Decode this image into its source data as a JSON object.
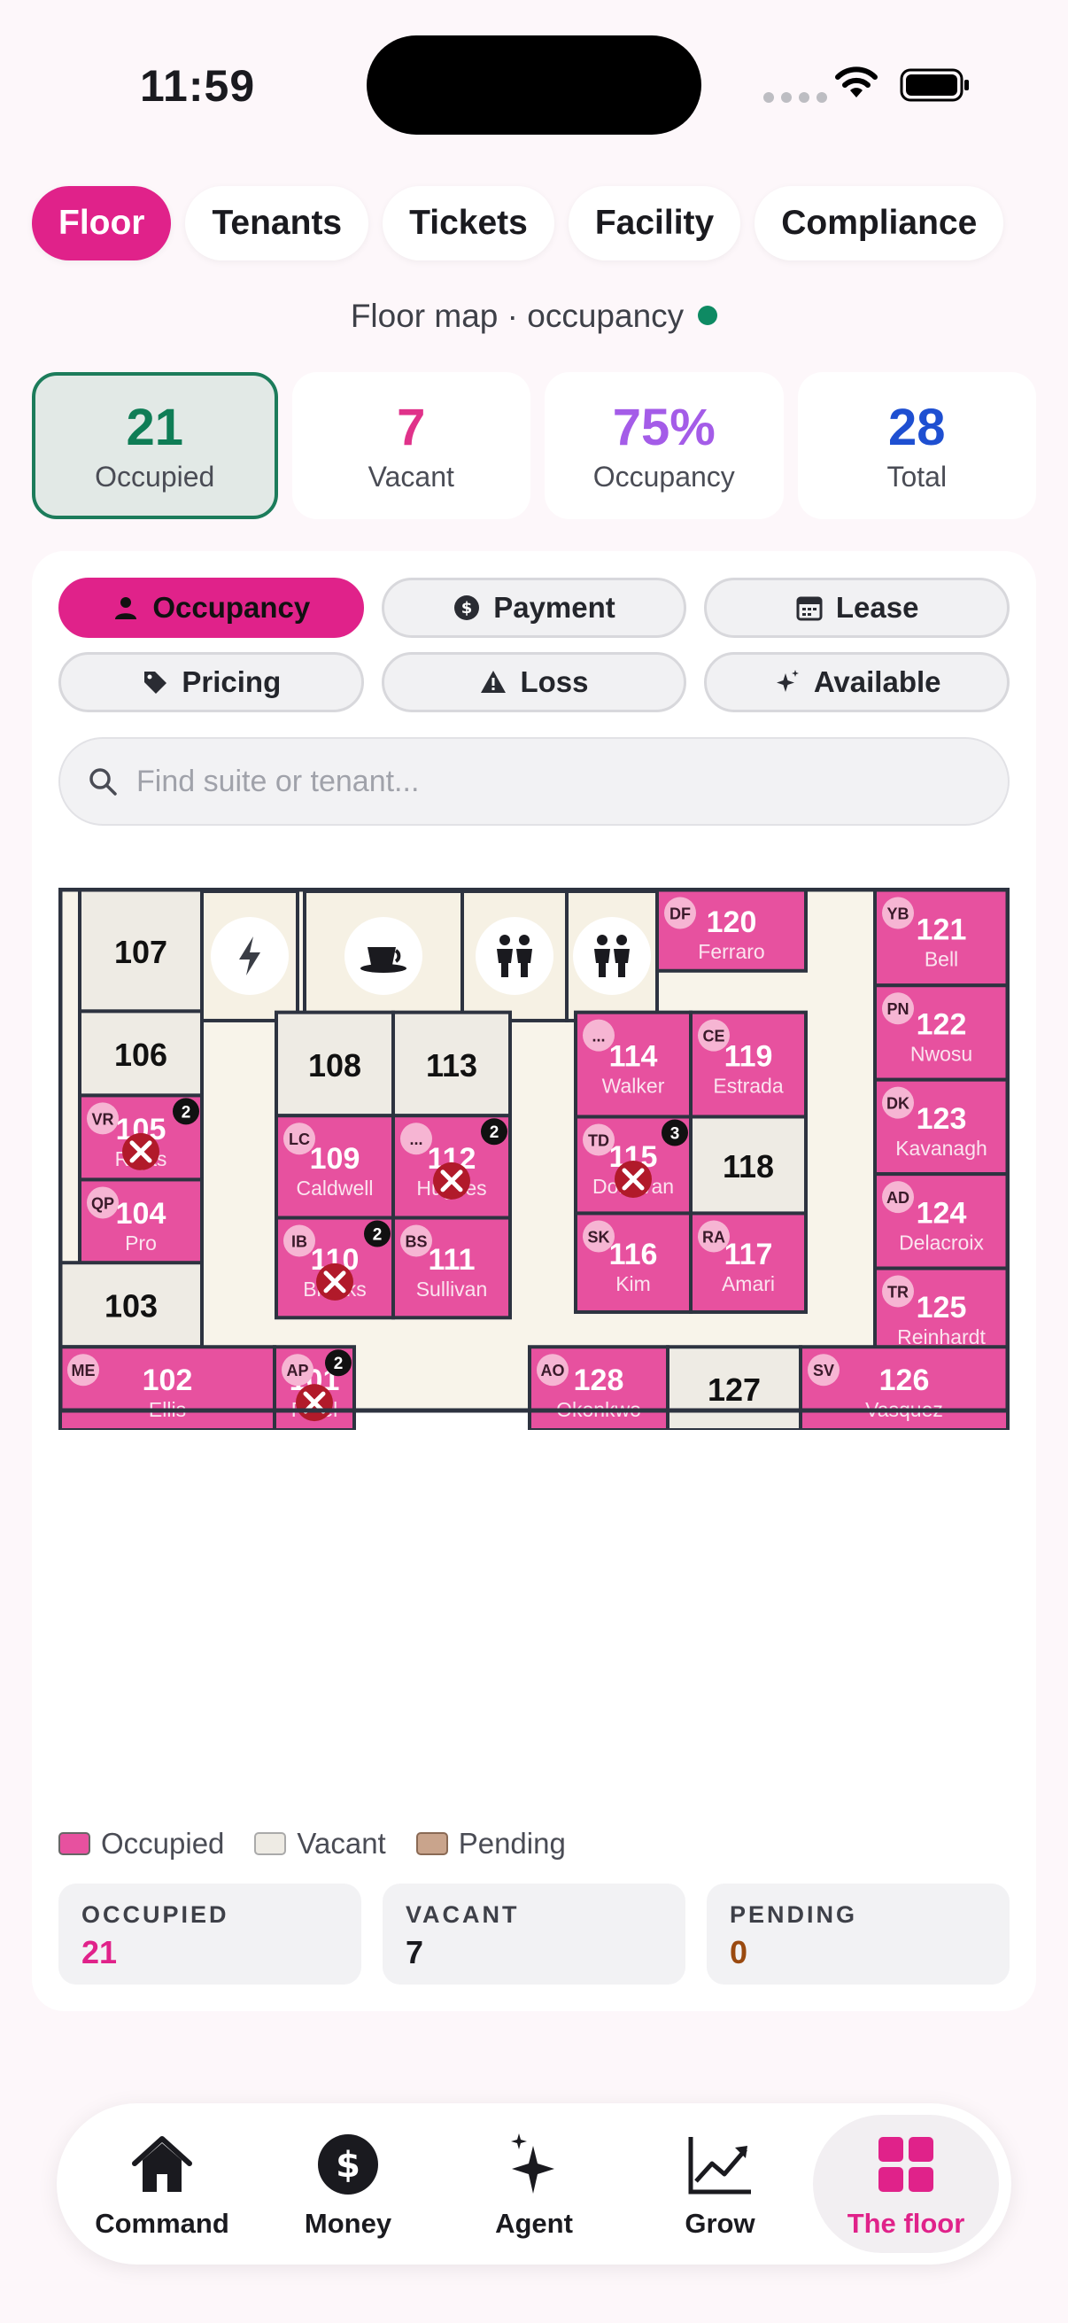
{
  "status_bar": {
    "time": "11:59"
  },
  "tabs": [
    {
      "label": "Floor",
      "active": true
    },
    {
      "label": "Tenants",
      "active": false
    },
    {
      "label": "Tickets",
      "active": false
    },
    {
      "label": "Facility",
      "active": false
    },
    {
      "label": "Compliance",
      "active": false
    }
  ],
  "subtitle": "Floor map · occupancy",
  "stats": [
    {
      "value": "21",
      "label": "Occupied",
      "color": "#0f7d56"
    },
    {
      "value": "7",
      "label": "Vacant",
      "color": "#e0328a"
    },
    {
      "value": "75%",
      "label": "Occupancy",
      "color": "#a45ce8"
    },
    {
      "value": "28",
      "label": "Total",
      "color": "#1e4fd1"
    }
  ],
  "filters": [
    {
      "label": "Occupancy",
      "icon": "person-icon",
      "active": true
    },
    {
      "label": "Payment",
      "icon": "dollar-icon",
      "active": false
    },
    {
      "label": "Lease",
      "icon": "calendar-icon",
      "active": false
    },
    {
      "label": "Pricing",
      "icon": "tag-icon",
      "active": false
    },
    {
      "label": "Loss",
      "icon": "warning-icon",
      "active": false
    },
    {
      "label": "Available",
      "icon": "sparkle-icon",
      "active": false
    }
  ],
  "search": {
    "placeholder": "Find suite or tenant..."
  },
  "colors": {
    "occupied": "#e7519f",
    "vacant": "#eeebe4",
    "pending": "#c9a48c",
    "accent": "#e0228a",
    "wall": "#2d3340"
  },
  "suites": [
    {
      "num": "107",
      "status": "vacant"
    },
    {
      "num": "106",
      "status": "vacant"
    },
    {
      "num": "105",
      "status": "occupied",
      "tenant": "Rojas",
      "initials": "VR",
      "tickets": "2"
    },
    {
      "num": "104",
      "status": "occupied",
      "tenant": "Pro",
      "initials": "QP"
    },
    {
      "num": "103",
      "status": "vacant"
    },
    {
      "num": "102",
      "status": "occupied",
      "tenant": "Ellis",
      "initials": "ME"
    },
    {
      "num": "101",
      "status": "occupied",
      "tenant": "Patel",
      "initials": "AP",
      "tickets": "2"
    },
    {
      "num": "108",
      "status": "vacant"
    },
    {
      "num": "113",
      "status": "vacant"
    },
    {
      "num": "109",
      "status": "occupied",
      "tenant": "Caldwell",
      "initials": "LC"
    },
    {
      "num": "112",
      "status": "occupied",
      "tenant": "Hughes",
      "initials": "...",
      "tickets": "2"
    },
    {
      "num": "110",
      "status": "occupied",
      "tenant": "Brooks",
      "initials": "IB",
      "tickets": "2"
    },
    {
      "num": "111",
      "status": "occupied",
      "tenant": "Sullivan",
      "initials": "BS"
    },
    {
      "num": "114",
      "status": "occupied",
      "tenant": "Walker",
      "initials": "..."
    },
    {
      "num": "119",
      "status": "occupied",
      "tenant": "Estrada",
      "initials": "CE"
    },
    {
      "num": "115",
      "status": "occupied",
      "tenant": "Donovan",
      "initials": "TD",
      "tickets": "3"
    },
    {
      "num": "118",
      "status": "vacant"
    },
    {
      "num": "116",
      "status": "occupied",
      "tenant": "Kim",
      "initials": "SK"
    },
    {
      "num": "117",
      "status": "occupied",
      "tenant": "Amari",
      "initials": "RA"
    },
    {
      "num": "120",
      "status": "occupied",
      "tenant": "Ferraro",
      "initials": "DF"
    },
    {
      "num": "121",
      "status": "occupied",
      "tenant": "Bell",
      "initials": "YB"
    },
    {
      "num": "122",
      "status": "occupied",
      "tenant": "Nwosu",
      "initials": "PN"
    },
    {
      "num": "123",
      "status": "occupied",
      "tenant": "Kavanagh",
      "initials": "DK"
    },
    {
      "num": "124",
      "status": "occupied",
      "tenant": "Delacroix",
      "initials": "AD"
    },
    {
      "num": "125",
      "status": "occupied",
      "tenant": "Reinhardt",
      "initials": "TR"
    },
    {
      "num": "128",
      "status": "occupied",
      "tenant": "Okonkwo",
      "initials": "AO"
    },
    {
      "num": "127",
      "status": "vacant"
    },
    {
      "num": "126",
      "status": "occupied",
      "tenant": "Vasquez",
      "initials": "SV"
    }
  ],
  "amenities": [
    {
      "icon": "lightning-icon"
    },
    {
      "icon": "coffee-icon"
    },
    {
      "icon": "restroom-icon"
    },
    {
      "icon": "restroom-icon"
    }
  ],
  "legend": [
    {
      "label": "Occupied",
      "color": "#e7519f"
    },
    {
      "label": "Vacant",
      "color": "#eeebe4"
    },
    {
      "label": "Pending",
      "color": "#c9a48c"
    }
  ],
  "summary": [
    {
      "label": "OCCUPIED",
      "value": "21",
      "color": "#e0228a"
    },
    {
      "label": "VACANT",
      "value": "7",
      "color": "#1a1a1f"
    },
    {
      "label": "PENDING",
      "value": "0",
      "color": "#9a4a10"
    }
  ],
  "bottom_nav": [
    {
      "label": "Command",
      "icon": "home-icon",
      "active": false
    },
    {
      "label": "Money",
      "icon": "money-icon",
      "active": false
    },
    {
      "label": "Agent",
      "icon": "sparkles-icon",
      "active": false
    },
    {
      "label": "Grow",
      "icon": "chart-icon",
      "active": false
    },
    {
      "label": "The floor",
      "icon": "grid-icon",
      "active": true
    }
  ]
}
